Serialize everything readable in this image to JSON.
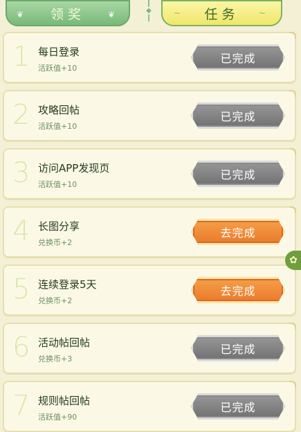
{
  "tabs": {
    "claim_label": "领奖",
    "task_label": "任务"
  },
  "tasks": [
    {
      "number": "1",
      "title": "每日登录",
      "reward": "活跃值+10",
      "status": "已完成",
      "state": "done"
    },
    {
      "number": "2",
      "title": "攻略回帖",
      "reward": "活跃值+10",
      "status": "已完成",
      "state": "done"
    },
    {
      "number": "3",
      "title": "访问APP发现页",
      "reward": "活跃值+10",
      "status": "已完成",
      "state": "done"
    },
    {
      "number": "4",
      "title": "长图分享",
      "reward": "兑换币+2",
      "status": "去完成",
      "state": "todo"
    },
    {
      "number": "5",
      "title": "连续登录5天",
      "reward": "兑换币+2",
      "status": "去完成",
      "state": "todo"
    },
    {
      "number": "6",
      "title": "活动帖回帖",
      "reward": "兑换币+3",
      "status": "已完成",
      "state": "done"
    },
    {
      "number": "7",
      "title": "规则帖回帖",
      "reward": "活跃值+90",
      "status": "已完成",
      "state": "done"
    }
  ],
  "colors": {
    "done_button": "#7d7d7d",
    "todo_button": "#ee8a35",
    "card_bg": "#fbf9e6",
    "tab_active": "#f0e66a",
    "tab_inactive": "#8cc28a"
  },
  "icons": {
    "divider": "ornament-icon",
    "side": "flower-icon"
  }
}
